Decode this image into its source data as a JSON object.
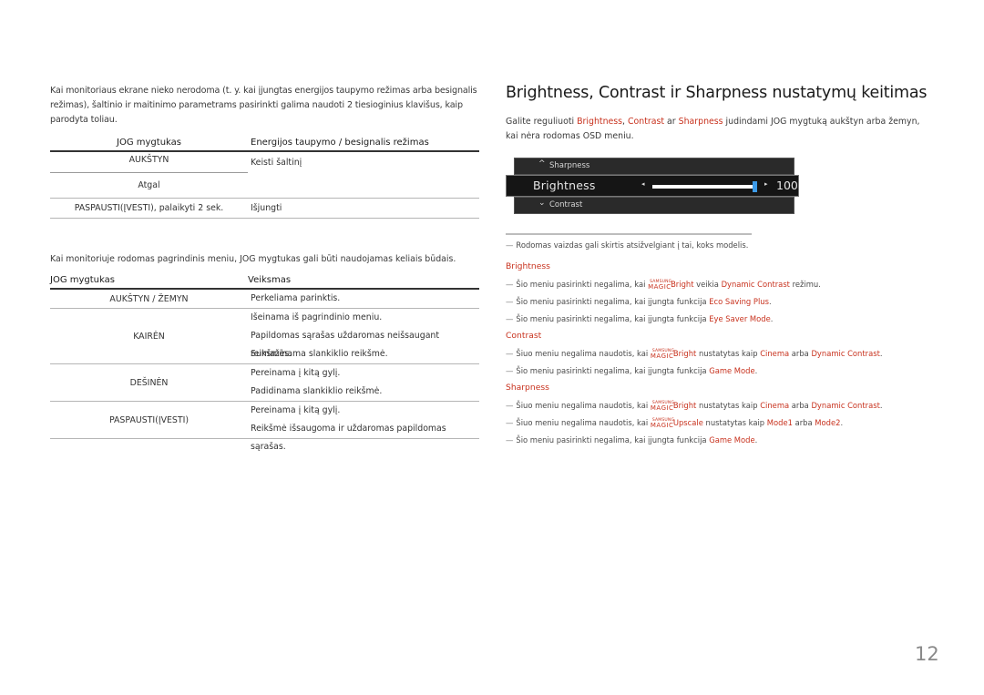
{
  "left": {
    "intro": "Kai monitoriaus ekrane nieko nerodoma (t. y. kai įjungtas energijos taupymo režimas arba besignalis režimas), šaltinio ir maitinimo parametrams pasirinkti galima naudoti 2 tiesioginius klavišus, kaip parodyta toliau.",
    "table1": {
      "headers": [
        "JOG mygtukas",
        "Energijos taupymo / besignalis režimas"
      ],
      "rows": [
        {
          "button": "AUKŠTYN",
          "action": "Keisti šaltinį"
        },
        {
          "button": "Atgal",
          "action": ""
        },
        {
          "button": "PASPAUSTI(ĮVESTI), palaikyti 2 sek.",
          "action": "Išjungti"
        }
      ]
    },
    "intro2": "Kai monitoriuje rodomas pagrindinis meniu, JOG mygtukas gali būti naudojamas keliais būdais.",
    "table2": {
      "headers": [
        "JOG mygtukas",
        "Veiksmas"
      ],
      "rows": [
        {
          "button": "AUKŠTYN / ŽEMYN",
          "actions": [
            "Perkeliama parinktis."
          ]
        },
        {
          "button": "KAIRĖN",
          "actions": [
            "Išeinama iš pagrindinio meniu.",
            "Papildomas sąrašas uždaromas neišsaugant reikšmės.",
            "Sumažinama slankiklio reikšmė."
          ]
        },
        {
          "button": "DEŠINĖN",
          "actions": [
            "Pereinama į kitą gylį.",
            "Padidinama slankiklio reikšmė."
          ]
        },
        {
          "button": "PASPAUSTI(ĮVESTI)",
          "actions": [
            "Pereinama į kitą gylį.",
            "Reikšmė išsaugoma ir uždaromas papildomas sąrašas."
          ]
        }
      ]
    }
  },
  "right": {
    "title": "Brightness, Contrast ir Sharpness nustatymų keitimas",
    "desc": {
      "p1": "Galite reguliuoti ",
      "brightness": "Brightness",
      "comma": ", ",
      "contrast": "Contrast",
      "ar": " ar ",
      "sharpness": "Sharpness",
      "p2": " judindami JOG mygtuką aukštyn arba žemyn, kai nėra rodomas OSD meniu."
    },
    "osd": {
      "prev_label": "Sharpness",
      "current_label": "Brightness",
      "next_label": "Contrast",
      "value": "100",
      "value_fraction": 1.0,
      "up_icon": "^",
      "down_icon": "⌄",
      "left_arrow": "◂",
      "right_arrow": "▸",
      "knob_color": "#3c9ae8"
    },
    "note": "Rodomas vaizdas gali skirtis atsižvelgiant į tai, koks modelis.",
    "magic_top": "SAMSUNG",
    "magic_bottom": "MAGIC",
    "sections": {
      "brightness": {
        "title": "Brightness",
        "items": [
          {
            "pre": "Šio meniu pasirinkti negalima, kai ",
            "brand": "Bright",
            "mid": " veikia ",
            "hl1": "Dynamic Contrast",
            "post": " režimu."
          },
          {
            "pre": "Šio meniu pasirinkti negalima, kai įjungta funkcija ",
            "hl1": "Eco Saving Plus",
            "post": "."
          },
          {
            "pre": "Šio meniu pasirinkti negalima, kai įjungta funkcija ",
            "hl1": "Eye Saver Mode",
            "post": "."
          }
        ]
      },
      "contrast": {
        "title": "Contrast",
        "items": [
          {
            "pre": "Šiuo meniu negalima naudotis, kai ",
            "brand": "Bright",
            "mid": " nustatytas kaip ",
            "hl1": "Cinema",
            "mid2": " arba ",
            "hl2": "Dynamic Contrast",
            "post": "."
          },
          {
            "pre": "Šio meniu pasirinkti negalima, kai įjungta funkcija ",
            "hl1": "Game Mode",
            "post": "."
          }
        ]
      },
      "sharpness": {
        "title": "Sharpness",
        "items": [
          {
            "pre": "Šiuo meniu negalima naudotis, kai ",
            "brand": "Bright",
            "mid": " nustatytas kaip ",
            "hl1": "Cinema",
            "mid2": " arba ",
            "hl2": "Dynamic Contrast",
            "post": "."
          },
          {
            "pre": "Šiuo meniu negalima naudotis, kai ",
            "brand": "Upscale",
            "mid": " nustatytas kaip ",
            "hl1": "Mode1",
            "mid2": " arba ",
            "hl2": "Mode2",
            "post": "."
          },
          {
            "pre": "Šio meniu pasirinkti negalima, kai įjungta funkcija ",
            "hl1": "Game Mode",
            "post": "."
          }
        ]
      }
    },
    "note_dash": "—",
    "accent_color": "#c8321e"
  },
  "page_number": "12"
}
